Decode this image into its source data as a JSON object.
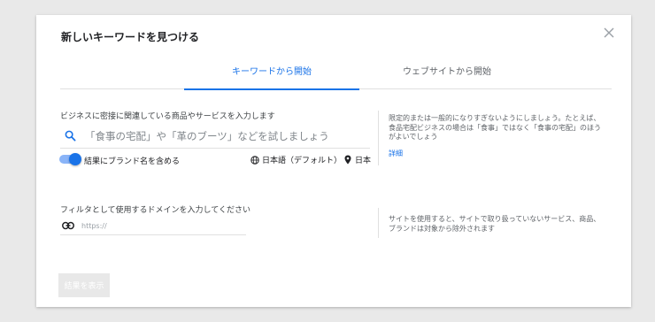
{
  "dialog": {
    "title": "新しいキーワードを見つける"
  },
  "tabs": [
    {
      "label": "キーワードから開始",
      "active": true
    },
    {
      "label": "ウェブサイトから開始",
      "active": false
    }
  ],
  "keyword_section": {
    "label": "ビジネスに密接に関連している商品やサービスを入力します",
    "search_placeholder": "「食事の宅配」や「革のブーツ」などを試しましょう",
    "toggle_label": "結果にブランド名を含める",
    "toggle_on": true,
    "language": "日本語（デフォルト）",
    "location": "日本",
    "help_text": "限定的または一般的になりすぎないようにしましょう。たとえば、食品宅配ビジネスの場合は「食事」ではなく「食事の宅配」のほうがよいでしょう",
    "help_link": "詳細"
  },
  "domain_section": {
    "label": "フィルタとして使用するドメインを入力してください",
    "placeholder": "https://",
    "help_text": "サイトを使用すると、サイトで取り扱っていないサービス、商品、ブランドは対象から除外されます"
  },
  "actions": {
    "submit_label": "結果を表示"
  },
  "colors": {
    "accent": "#1a73e8",
    "toggle_track": "#8ab4f8",
    "text_primary": "#202124",
    "text_secondary": "#5f6368",
    "divider": "#e0e0e0",
    "backdrop": "#e9e9e9",
    "disabled_button": "#e8e8e8"
  }
}
